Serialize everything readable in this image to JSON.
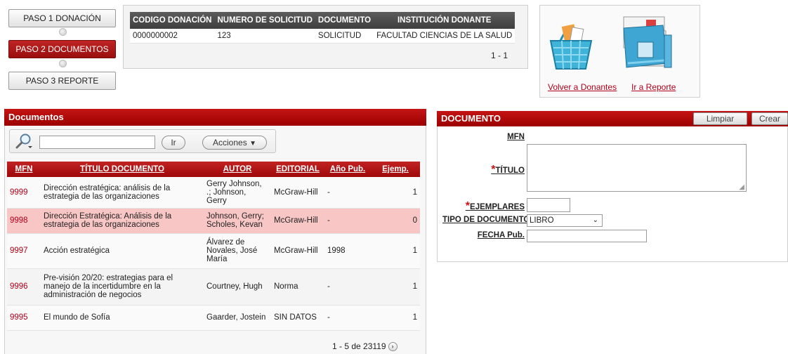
{
  "wizard": {
    "steps": [
      {
        "label": "PASO 1 DONACIÓN"
      },
      {
        "label": "PASO 2 DOCUMENTOS"
      },
      {
        "label": "PASO 3 REPORTE"
      }
    ]
  },
  "donation_summary": {
    "headers": [
      "CODIGO DONACIÓN",
      "NUMERO DE SOLICITUD",
      "DOCUMENTO",
      "INSTITUCIÓN DONANTE"
    ],
    "row": [
      "0000000002",
      "123",
      "SOLICITUD",
      "FACULTAD CIENCIAS DE LA SALUD"
    ],
    "pagination": "1 - 1"
  },
  "nav": {
    "back_label": "Volver a Donantes",
    "report_label": "Ir a Reporte"
  },
  "documents": {
    "title": "Documentos",
    "go_label": "Ir",
    "actions_label": "Acciones",
    "headers": {
      "mfn": "MFN",
      "title": "TÍTULO DOCUMENTO",
      "author": "AUTOR",
      "publisher": "EDITORIAL",
      "year": "Año Pub.",
      "copies": "Ejemp."
    },
    "rows": [
      {
        "mfn": "9999",
        "title": "Dirección estratégica: análisis de la estrategia de las organizaciones",
        "author": "Gerry Johnson, .; Johnson, Gerry",
        "publisher": "McGraw-Hill",
        "year": "-",
        "copies": "1"
      },
      {
        "mfn": "9998",
        "title": "Dirección Estratégica: Análisis de la estrategia de las organizaciones",
        "author": "Johnson, Gerry; Scholes, Kevan",
        "publisher": "McGraw-Hill",
        "year": "-",
        "copies": "0"
      },
      {
        "mfn": "9997",
        "title": "Acción estratégica",
        "author": "Álvarez de Novales, José María",
        "publisher": "McGraw-Hill",
        "year": "1998",
        "copies": "1"
      },
      {
        "mfn": "9996",
        "title": "Pre-visión 20/20: estrategias para el manejo de la incertidumbre en la administración de negocios",
        "author": "Courtney, Hugh",
        "publisher": "Norma",
        "year": "-",
        "copies": "1"
      },
      {
        "mfn": "9995",
        "title": "El mundo de Sofía",
        "author": "Gaarder, Jostein",
        "publisher": "SIN DATOS",
        "year": "-",
        "copies": "1"
      }
    ],
    "pagination": "1 - 5 de 23119"
  },
  "form": {
    "title": "DOCUMENTO",
    "clear_label": "Limpiar",
    "create_label": "Crear",
    "mfn_label": "MFN",
    "title_label": "TÍTULO",
    "copies_label": "EJEMPLARES",
    "type_label": "TIPO DE DOCUMENTO",
    "type_value": "LIBRO",
    "date_label": "FECHA Pub.",
    "required_mark": "*"
  },
  "colors": {
    "brand_red": "#a80c0c",
    "highlight_row": "#f9c6c6",
    "link_red": "#b0001a"
  }
}
